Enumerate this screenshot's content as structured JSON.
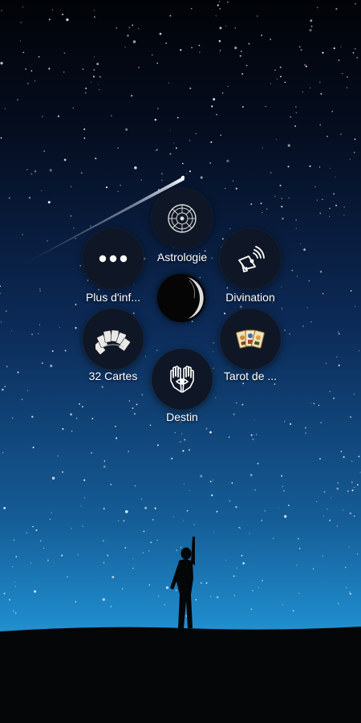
{
  "menu": {
    "items": [
      {
        "label": "Astrologie",
        "icon": "zodiac-wheel-icon"
      },
      {
        "label": "Divination",
        "icon": "megaphone-icon"
      },
      {
        "label": "Tarot de ...",
        "icon": "tarot-cards-icon"
      },
      {
        "label": "Destin",
        "icon": "hands-eye-icon"
      },
      {
        "label": "32 Cartes",
        "icon": "card-fan-icon"
      },
      {
        "label": "Plus d'inf...",
        "icon": "more-dots-icon"
      }
    ],
    "center_icon": "crescent-moon-icon"
  },
  "colors": {
    "sky_top": "#02060f",
    "sky_mid": "#0b2a5a",
    "sky_horizon": "#1f86c8",
    "ground": "#050608",
    "node_bg": "#0f1726",
    "icon_gold": "#e6c98a",
    "icon_white": "#ffffff"
  }
}
